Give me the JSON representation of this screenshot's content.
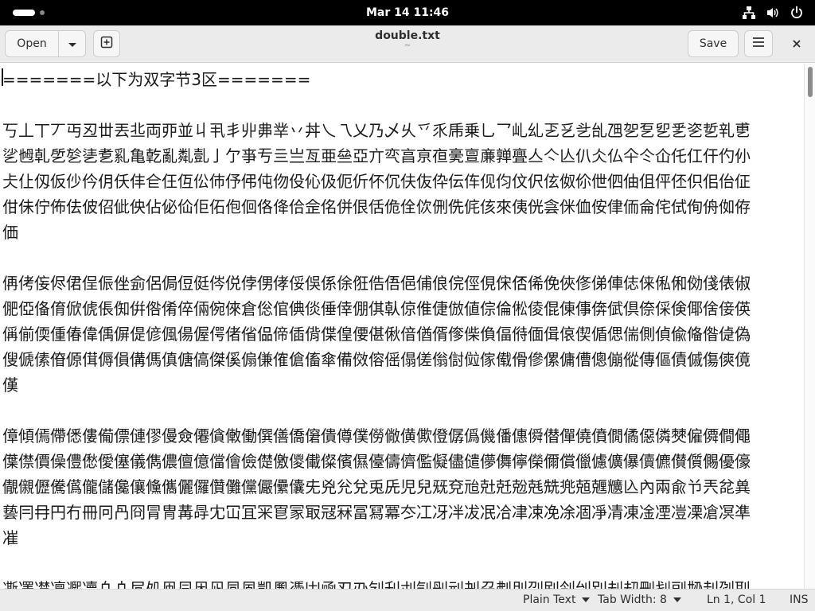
{
  "topbar": {
    "clock": "Mar 14  11:46",
    "icons": [
      "network-icon",
      "volume-icon",
      "power-icon"
    ]
  },
  "headerbar": {
    "open_label": "Open",
    "title": "double.txt",
    "subtitle": "~",
    "save_label": "Save"
  },
  "editor": {
    "lines": [
      "=======以下为双字节3区=======",
      "",
      "丂丄丅丆丏丒丗丟丠両丣並丩丮丯丱丳丵丷丼乀乁乂乃乄乆乊乑乕乗乚乛乢乣乤乥乧乨乪乫乭乮乯乲乴乵乶乷乸乹乺乻乼乽乿亀亁亂亃亄亅亇亊亐亖亗亙亜亝亞亣亪亯亰亱亴亶亷亸亹亼亽亾仈仌仏仐仒仚仛仜仠仢仦仧仩仭仮仯仱仴仸仹仺仼仾伀伂伃伄伅伆伇伈伋伌伒伓伔伕伖伜伝伡伣伨伩伬伭伮伱伳伵伷伹伻伾伿佀佁佂佄佅佇佈佉佊佋佌佒佔佖佡佢佦佨佪佫佭佮佱佲併佷佸佹佺佽侀侁侂侅來侇侊侌侎侐侒侓侕侖侘侙侚侜侞侟価",
      "",
      "侢侤侫侭侰侱侲侳侴侶侷侸侹侺侻侼侽侾俀俁係俆俇俈俉俋俌俍俒俓俔俕俖俙俛俠俢俤俥俧俫俬俰俲俴俵俶俷俹俻俼俽俿倀倁倂倃倄倅倆倇倈倉倊倌倎倓倕倖倗倛倝倞倠倢倣値倧倫倯倰倱倲倳倴倵倶倷倸倹倻倽倿偀偁偂偄偅偆偉偊偋偍偐偑偒偓偔偖偗偘偙偛偝偞偟偠偡偢偣偤偦偧偨偩偪偫偭偮偯偰偱偲偳側偵偸偹偺偼偽傁傂傃傄傆傇傉傊傋傌傎傏傐傑傒傓傔傕傖傗傘備傚傛傜傝傞傟傠傡傢傤傦傪傫傭傮傯傰傱傳傴債傶傷傸傹傼",
      "",
      "傽傾傿僀僁僂僃僄僆僇僈僉僊僋僌働僎僐僑僒僓僔僕僗僘僙僛僜僝僞僟僠僡僢僣僤僥僨僩僪僫僯僰僱僲僴僶僷僸價僺僼僽僾僿儀儁儂儃億儅儈儉儊儌儍儎儏儐儑儓儔儕儖儗儘儙儚儛儜儝儞償儠儢儣儤儥儦儧儨儩優儫儬儭儮儯儰儱儲儳儴儵儶儷儸儹儺儻儼儽儾兂兇兊兌兎兏児兒兓兗兘兙兛兝兞兟兠兡兣兤兦內兩兪兯兲兺兾兿冃冄円冇冊冋冎冏冐冑冓冔冘冚冝冞冟冡冣冦冧冨冩冪冭冮冴冸冹冺冾冿凁凂凃凅凈凊凍凎凐凒凓凔凕凖凗",
      "",
      "凘凙凚凜凞凟凢凣凥処凧凨凩凪凬凮凱凲凴凷凾刄刅刉刋刌刏刐刓刔刕刜刞刟刡刢刣別刦刧刪刬刯刱刲刴刵刼刾剄剅剆則剈剉剋剎剏剒剓剕剗剘"
    ]
  },
  "statusbar": {
    "language": "Plain Text",
    "tab_width": "Tab Width: 8",
    "position": "Ln 1, Col 1",
    "mode": "INS"
  }
}
